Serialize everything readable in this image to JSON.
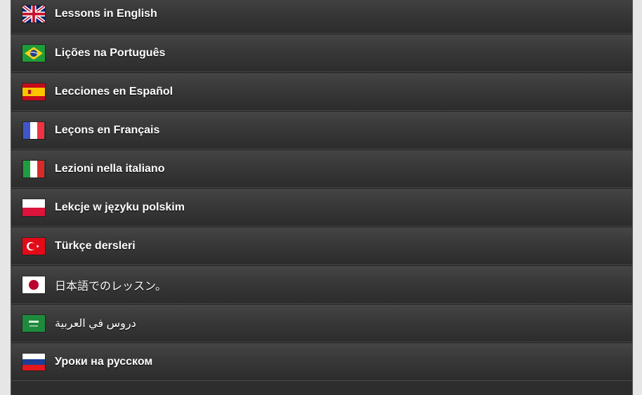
{
  "languages": [
    {
      "label": "Lessons in English",
      "flag_icon": "flag-uk-icon"
    },
    {
      "label": "Lições na Português",
      "flag_icon": "flag-brazil-icon"
    },
    {
      "label": "Lecciones en Español",
      "flag_icon": "flag-spain-icon"
    },
    {
      "label": "Leçons en Français",
      "flag_icon": "flag-france-icon"
    },
    {
      "label": "Lezioni nella italiano",
      "flag_icon": "flag-italy-icon"
    },
    {
      "label": "Lekcje w języku polskim",
      "flag_icon": "flag-poland-icon"
    },
    {
      "label": "Türkçe dersleri",
      "flag_icon": "flag-turkey-icon"
    },
    {
      "label": "日本語でのレッスン。",
      "flag_icon": "flag-japan-icon"
    },
    {
      "label": "دروس في العربية",
      "flag_icon": "flag-saudi-arabia-icon"
    },
    {
      "label": "Уроки на русском",
      "flag_icon": "flag-russia-icon"
    }
  ],
  "colors": {
    "row_top": "#454545",
    "row_bottom": "#2c2c2c",
    "text": "#ffffff",
    "page_background": "#e6e6e6"
  }
}
